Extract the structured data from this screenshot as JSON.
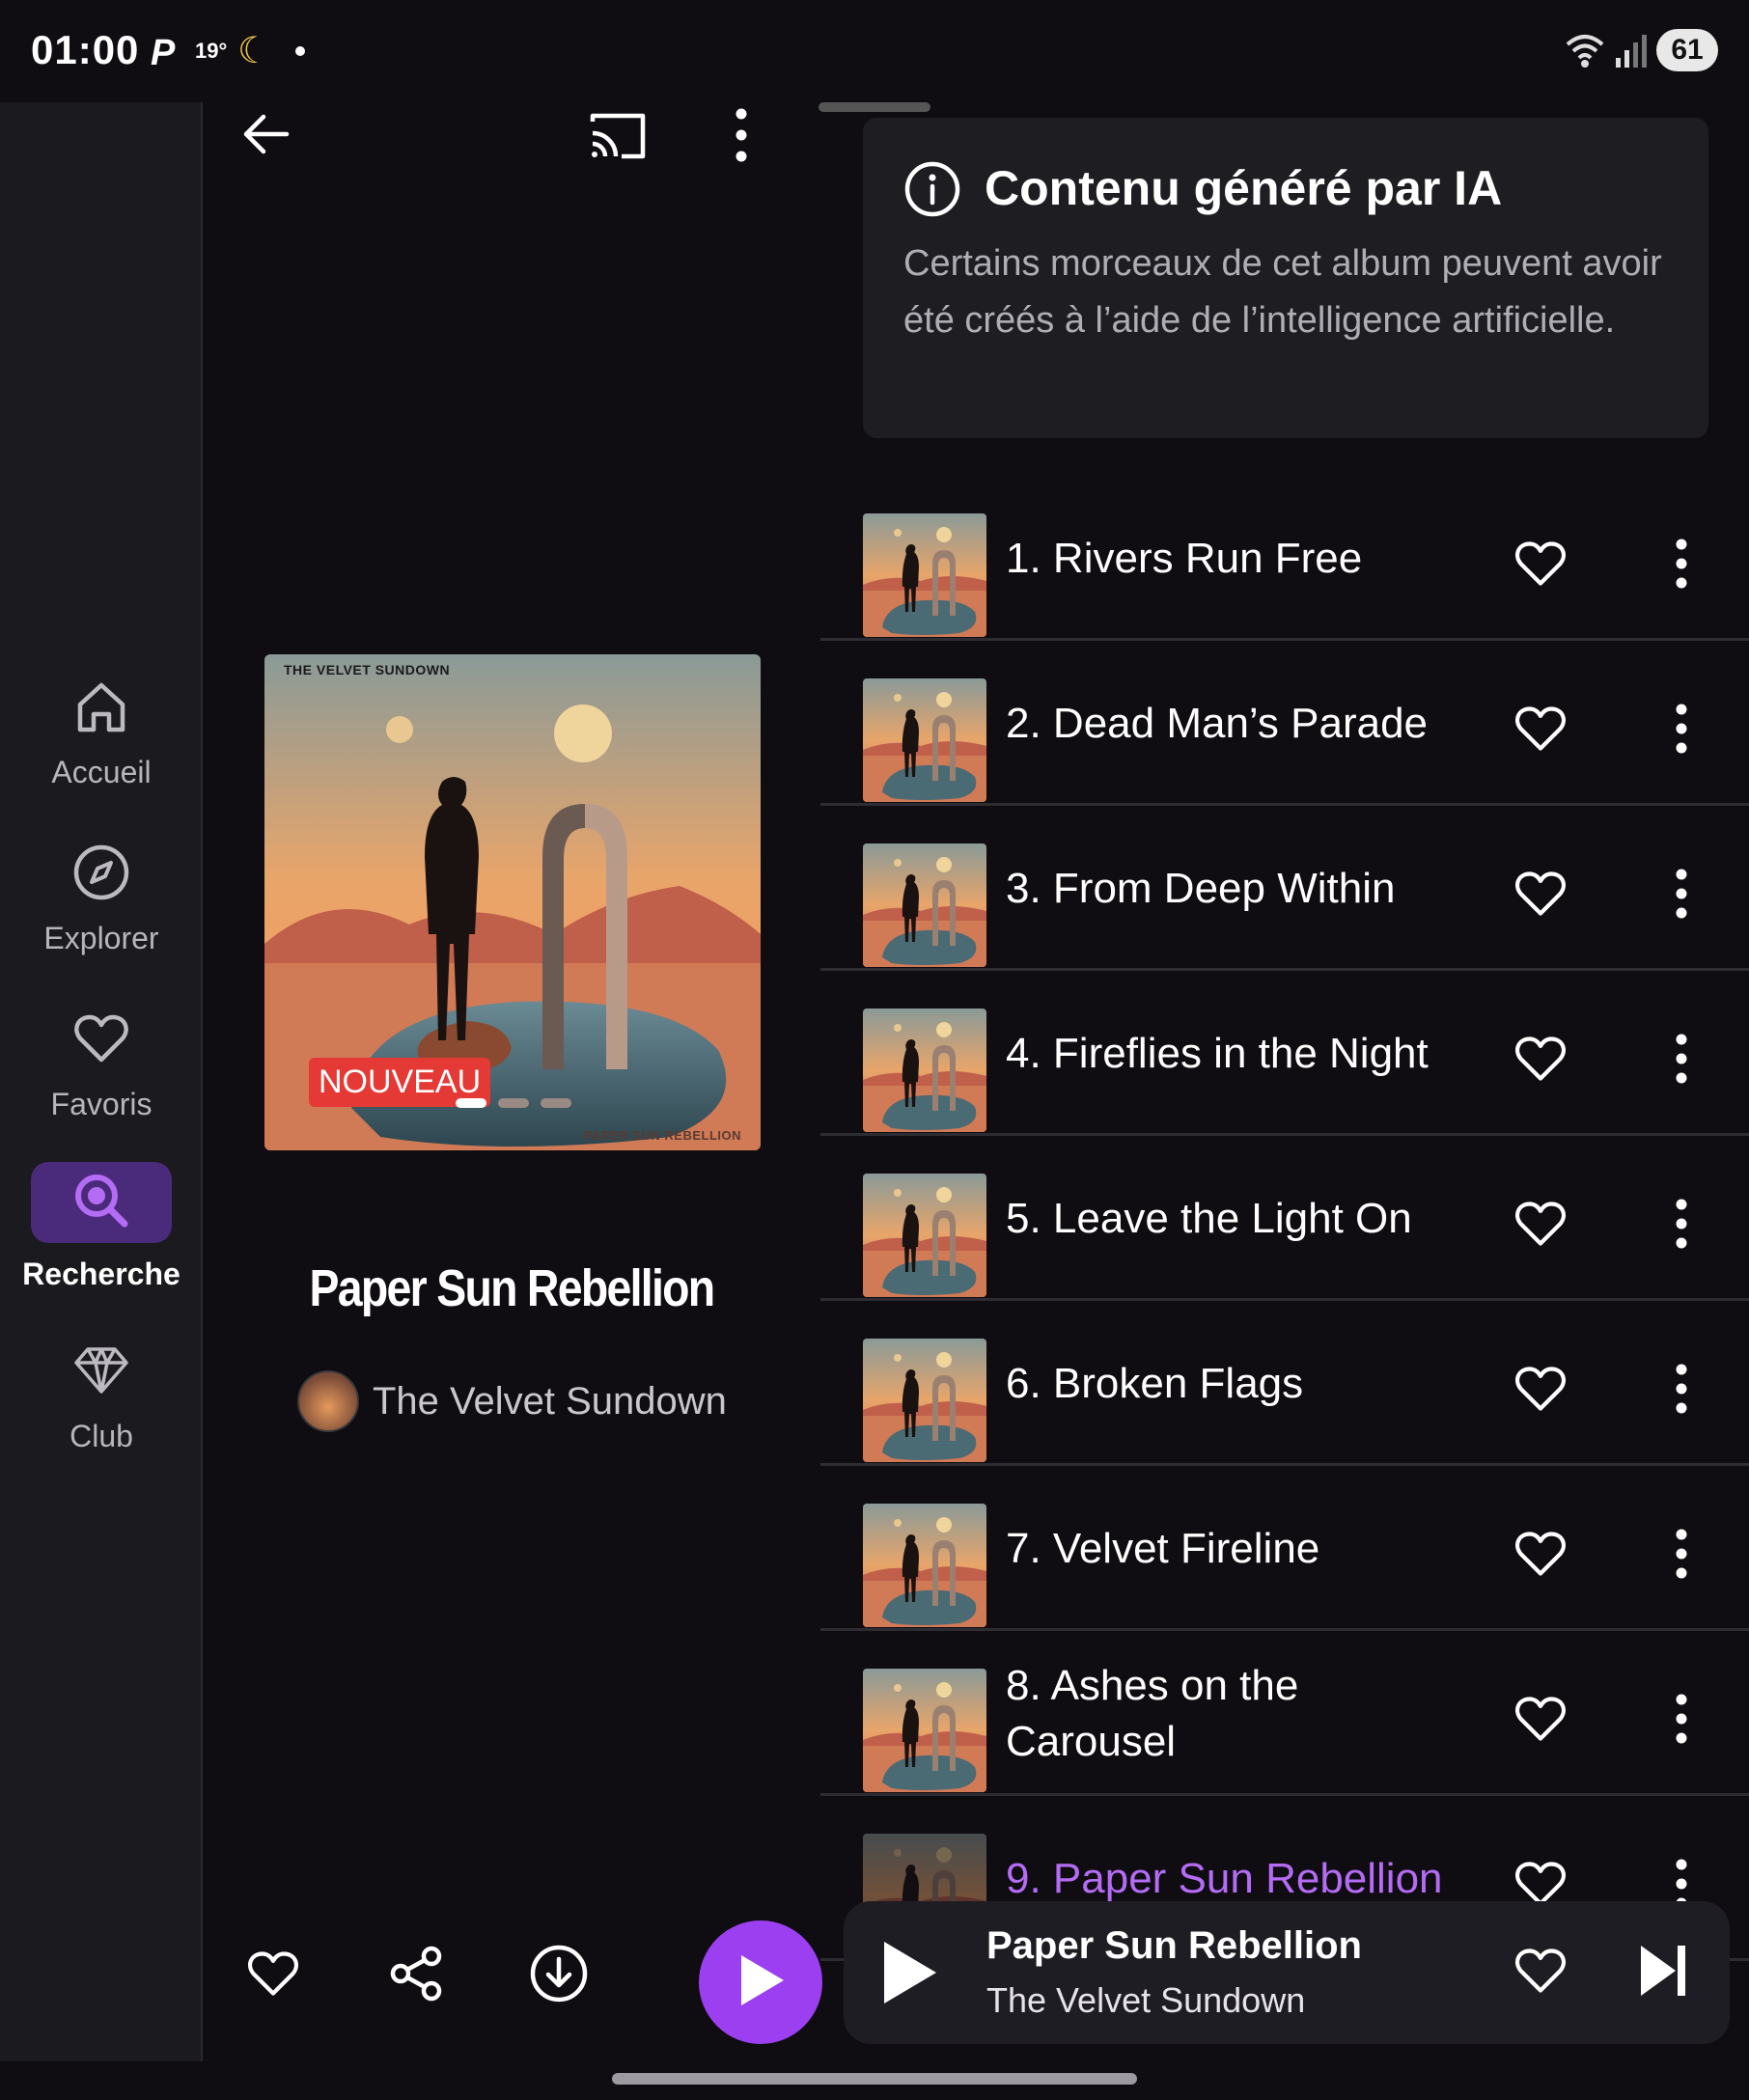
{
  "status_bar": {
    "time": "01:00",
    "paypal_glyph": "P",
    "temperature": "19°",
    "battery": "61"
  },
  "nav": {
    "items": [
      {
        "label": "Accueil",
        "icon": "home-icon",
        "active": false
      },
      {
        "label": "Explorer",
        "icon": "compass-icon",
        "active": false
      },
      {
        "label": "Favoris",
        "icon": "heart-icon",
        "active": false
      },
      {
        "label": "Recherche",
        "icon": "search-icon",
        "active": true
      },
      {
        "label": "Club",
        "icon": "diamond-icon",
        "active": false
      }
    ]
  },
  "album": {
    "cover_band": "THE VELVET SUNDOWN",
    "cover_caption": "PAPER SUN REBELLION",
    "badge": "NOUVEAU",
    "title": "Paper Sun Rebellion",
    "artist": "The Velvet Sundown"
  },
  "ai_notice": {
    "title": "Contenu généré par IA",
    "body": "Certains morceaux de cet album peuvent avoir été créés à l’aide de l’intelligence artificielle."
  },
  "tracks": [
    {
      "title": "1. Rivers Run Free",
      "playing": false
    },
    {
      "title": "2. Dead Man’s Parade",
      "playing": false
    },
    {
      "title": "3. From Deep Within",
      "playing": false
    },
    {
      "title": "4. Fireflies in the Night",
      "playing": false
    },
    {
      "title": "5. Leave the Light On",
      "playing": false
    },
    {
      "title": "6. Broken Flags",
      "playing": false
    },
    {
      "title": "7. Velvet Fireline",
      "playing": false
    },
    {
      "title": "8. Ashes on the Carousel",
      "playing": false
    },
    {
      "title": "9. Paper Sun Rebellion",
      "playing": true
    }
  ],
  "now_playing": {
    "title": "Paper Sun Rebellion",
    "artist": "The Velvet Sundown"
  },
  "colors": {
    "accent": "#9b3ff0",
    "accent_text": "#b56cf5",
    "background": "#0f0c12",
    "rail_background": "#1b1a1e",
    "badge": "#e53935"
  }
}
